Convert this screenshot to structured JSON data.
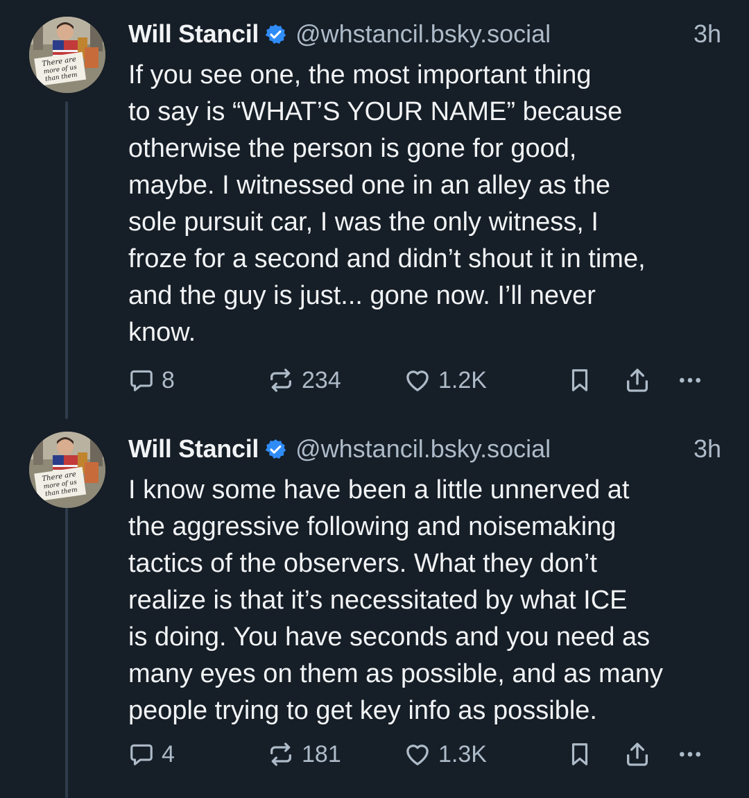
{
  "posts": [
    {
      "author_name": "Will Stancil",
      "handle": "@whstancil.bsky.social",
      "time": "3h",
      "avatar_sign_text": [
        "There are",
        "more of us",
        "than them"
      ],
      "text_lines": [
        "If you see one, the most important thing",
        "to say is “WHAT’S YOUR NAME” because",
        "otherwise the person is gone for good,",
        "maybe. I witnessed one in an alley as the",
        "sole pursuit car, I was the only witness, I",
        "froze for a second and didn’t shout it in time,",
        "and the guy is just... gone now. I’ll never",
        "know."
      ],
      "replies": "8",
      "reposts": "234",
      "likes": "1.2K"
    },
    {
      "author_name": "Will Stancil",
      "handle": "@whstancil.bsky.social",
      "time": "3h",
      "avatar_sign_text": [
        "There are",
        "more of us",
        "than them"
      ],
      "text_lines": [
        "I know some have been a little unnerved at",
        "the aggressive following and noisemaking",
        "tactics of the observers. What they don’t",
        "realize is that it’s necessitated by what ICE",
        "is doing. You have seconds and you need as",
        "many eyes on them as possible, and as many",
        "people trying to get key info as possible."
      ],
      "replies": "4",
      "reposts": "181",
      "likes": "1.3K"
    }
  ],
  "icons": {
    "verified": "verified-badge-icon",
    "reply": "reply-bubble-icon",
    "repost": "repost-icon",
    "like": "heart-icon",
    "save": "bookmark-icon",
    "share": "share-icon",
    "more": "more-dots-icon"
  },
  "colors": {
    "background": "#161e27",
    "text": "#f1f3f5",
    "muted": "#aebbc9",
    "verified": "#2f8cf7",
    "thread_line": "#2e3c4b"
  }
}
